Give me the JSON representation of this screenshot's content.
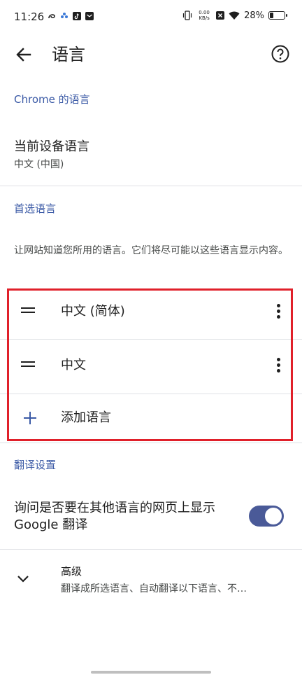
{
  "status_bar": {
    "time": "11:26",
    "net_speed_value": "0.00",
    "net_speed_unit": "KB/s",
    "battery": "28%",
    "battery_level": 0.28
  },
  "app_bar": {
    "title": "语言"
  },
  "sections": {
    "chrome_language": {
      "header": "Chrome 的语言",
      "device_language_title": "当前设备语言",
      "device_language_value": "中文 (中国)"
    },
    "preferred": {
      "header": "首选语言",
      "description": "让网站知道您所用的语言。它们将尽可能以这些语言显示内容。",
      "languages": [
        {
          "label": "中文 (简体)"
        },
        {
          "label": "中文"
        }
      ],
      "add_language": "添加语言"
    },
    "translate": {
      "header": "翻译设置",
      "offer_translate": "询问是否要在其他语言的网页上显示 Google 翻译",
      "offer_translate_enabled": true
    },
    "advanced": {
      "title": "高级",
      "subtitle": "翻译成所选语言、自动翻译以下语言、不…"
    }
  },
  "colors": {
    "accent": "#3b5aa6",
    "toggle_track": "#4a5a98",
    "highlight": "#e0202a"
  }
}
